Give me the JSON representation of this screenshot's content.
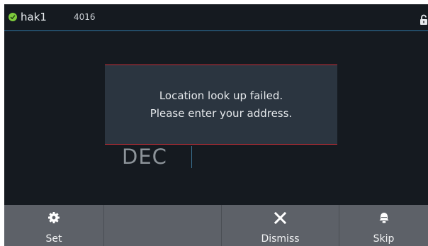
{
  "header": {
    "device_name": "hak1",
    "device_code": "4016",
    "status": "online",
    "lock_icon": "unlock-icon"
  },
  "background": {
    "time_label": "DEC"
  },
  "dialog": {
    "line1": "Location look up failed.",
    "line2": "Please enter your address."
  },
  "bottom_bar": {
    "buttons": [
      {
        "label": "Set",
        "icon": "gear-icon"
      },
      {
        "label": "",
        "icon": ""
      },
      {
        "label": "Dismiss",
        "icon": "close-icon"
      },
      {
        "label": "Skip",
        "icon": "bell-icon"
      }
    ]
  },
  "colors": {
    "accent_line": "#2f79a8",
    "dialog_border": "#c9303a",
    "status_ok": "#7ecb3c"
  }
}
